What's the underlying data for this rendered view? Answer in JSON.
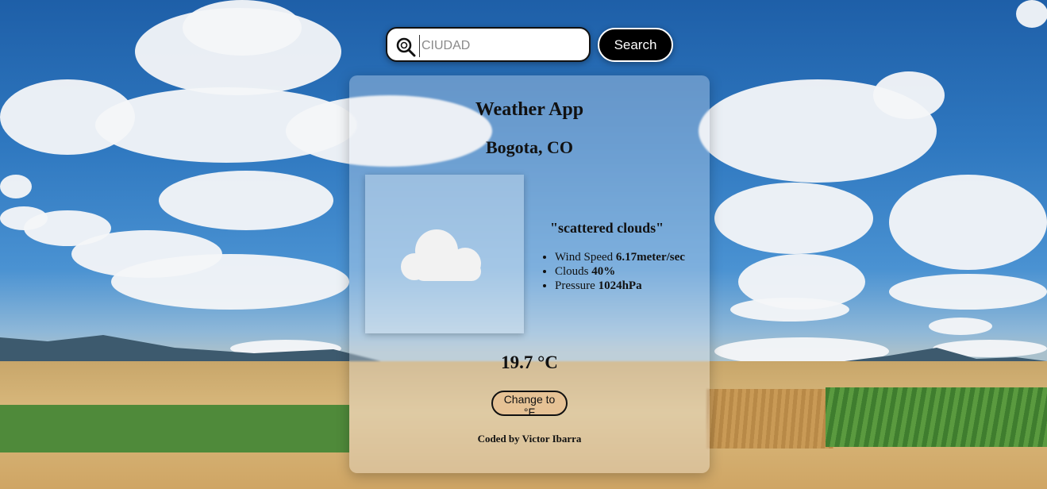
{
  "search": {
    "placeholder": "CIUDAD",
    "value": "",
    "button_label": "Search"
  },
  "card": {
    "app_title": "Weather App",
    "city": "Bogota, CO",
    "description": "\"scattered clouds\"",
    "icon": "cloud-icon",
    "details": [
      {
        "label": "Wind Speed ",
        "value": "6.17meter/sec"
      },
      {
        "label": "Clouds ",
        "value": "40%"
      },
      {
        "label": "Pressure ",
        "value": "1024hPa"
      }
    ],
    "temperature": "19.7 °C",
    "unit_toggle_label": "Change to °F",
    "credit": "Coded by Victor Ibarra"
  },
  "colors": {
    "search_button_bg": "#000000",
    "unit_button_bg": "#e6c295",
    "sky": "#2f78c0"
  }
}
